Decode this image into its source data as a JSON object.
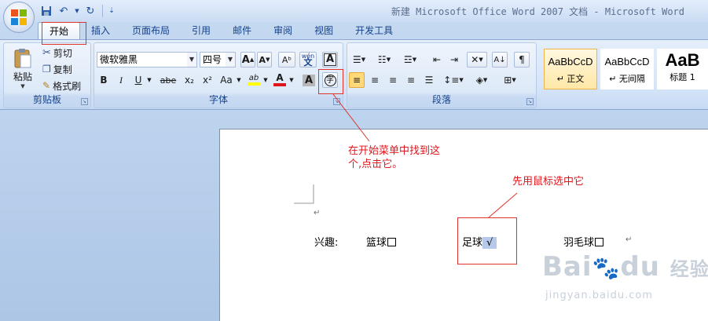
{
  "window": {
    "title": "新建 Microsoft Office Word 2007 文档 - Microsoft Word"
  },
  "qat": {
    "save_icon": "save-icon",
    "undo_icon": "undo-icon",
    "redo_icon": "redo-icon",
    "customize_icon": "customize-icon"
  },
  "tabs": [
    {
      "label": "开始",
      "active": true
    },
    {
      "label": "插入"
    },
    {
      "label": "页面布局"
    },
    {
      "label": "引用"
    },
    {
      "label": "邮件"
    },
    {
      "label": "审阅"
    },
    {
      "label": "视图"
    },
    {
      "label": "开发工具"
    }
  ],
  "clipboard": {
    "label": "剪贴板",
    "paste": "粘贴",
    "cut": "剪切",
    "copy": "复制",
    "format_painter": "格式刷"
  },
  "font": {
    "label": "字体",
    "font_name": "微软雅黑",
    "font_size": "四号",
    "bold": "B",
    "italic": "I",
    "underline": "U",
    "strikethrough": "abe",
    "subscript": "x₂",
    "superscript": "x²",
    "change_case": "Aa",
    "grow": "A",
    "shrink": "A",
    "phonetic": "wén",
    "char_border": "A",
    "char_shading": "A",
    "enclose": "字",
    "highlight": "ab",
    "font_color": "A"
  },
  "paragraph": {
    "label": "段落"
  },
  "styles": {
    "items": [
      {
        "preview": "AaBbCcD",
        "name": "↵ 正文",
        "selected": true
      },
      {
        "preview": "AaBbCcD",
        "name": "↵ 无间隔"
      },
      {
        "preview": "AaB",
        "name": "标题 1"
      }
    ]
  },
  "annotations": {
    "menu_hint": [
      "在开始菜单中找到这",
      "个,点击它。"
    ],
    "select_hint": "先用鼠标选中它"
  },
  "document": {
    "para_mark": "↵",
    "interest_label": "兴趣:",
    "items": [
      {
        "text": "篮球"
      },
      {
        "text": "足球",
        "mark": "√"
      },
      {
        "text": "羽毛球"
      }
    ]
  },
  "watermark": {
    "brand": "Bai",
    "brand2": "du",
    "cn": "经验",
    "url": "jingyan.baidu.com"
  },
  "colors": {
    "annotation_red": "#e0332e",
    "highlight_yellow": "#ffff00",
    "font_red": "#e0151b",
    "selection_blue": "#b6c9ea"
  }
}
